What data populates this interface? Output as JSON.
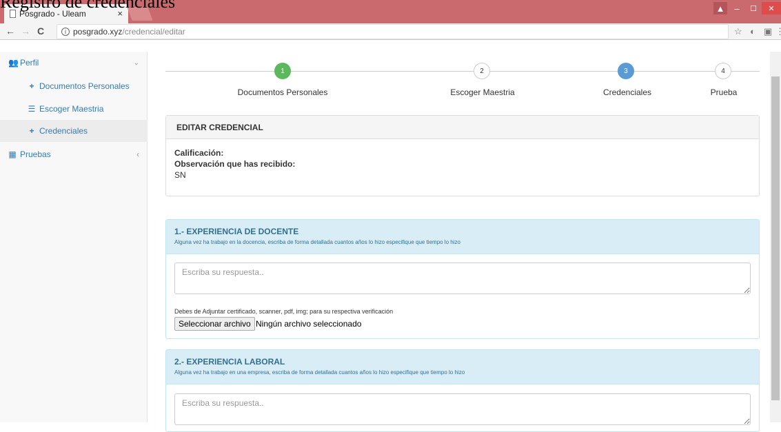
{
  "overlay_title": "Registro de credenciales",
  "browser": {
    "tab_title": "Posgrado - Uleam",
    "tab_close": "×",
    "url_host": "posgrado.xyz",
    "url_path": "/credencial/editar",
    "window_controls": [
      "▲",
      "–",
      "☐",
      "✕"
    ]
  },
  "sidebar": {
    "items": [
      {
        "label": "Perfil",
        "icon": "users-icon",
        "chevron": "⌄"
      },
      {
        "label": "Documentos Personales",
        "icon": "plus-icon"
      },
      {
        "label": "Escoger Maestria",
        "icon": "list-icon"
      },
      {
        "label": "Credenciales",
        "icon": "plus-icon"
      },
      {
        "label": "Pruebas",
        "icon": "table-icon",
        "chevron": "‹"
      }
    ]
  },
  "wizard": {
    "steps": [
      {
        "num": "1",
        "label": "Documentos Personales",
        "state": "done"
      },
      {
        "num": "2",
        "label": "Escoger Maestria",
        "state": "todo"
      },
      {
        "num": "3",
        "label": "Credenciales",
        "state": "active"
      },
      {
        "num": "4",
        "label": "Prueba",
        "state": "todo"
      }
    ],
    "colors": {
      "done": "#5cb85c",
      "active": "#5b9bd5",
      "todo": "#ffffff"
    }
  },
  "edit_panel": {
    "title": "EDITAR CREDENCIAL",
    "calificacion_label": "Calificación:",
    "observacion_label": "Observación que has recibido:",
    "observacion_value": "SN"
  },
  "section1": {
    "title": "1.- EXPERIENCIA DE DOCENTE",
    "subtitle": "Alguna vez ha trabajo en la docencia, escriba de forma detallada cuantos años lo hizo especifique que tiempo lo hizo",
    "placeholder": "Escriba su respuesta..",
    "attach_hint": "Debes de Adjuntar certificado, scanner, pdf, img; para su respectiva verificación",
    "file_button": "Seleccionar archivo",
    "file_status": "Ningún archivo seleccionado"
  },
  "section2": {
    "title": "2.- EXPERIENCIA LABORAL",
    "subtitle": "Alguna vez ha trabajo en una empresa, escriba de forma detallada cuantos años lo hizo especifique que tiempo lo hizo",
    "placeholder": "Escriba su respuesta.."
  }
}
